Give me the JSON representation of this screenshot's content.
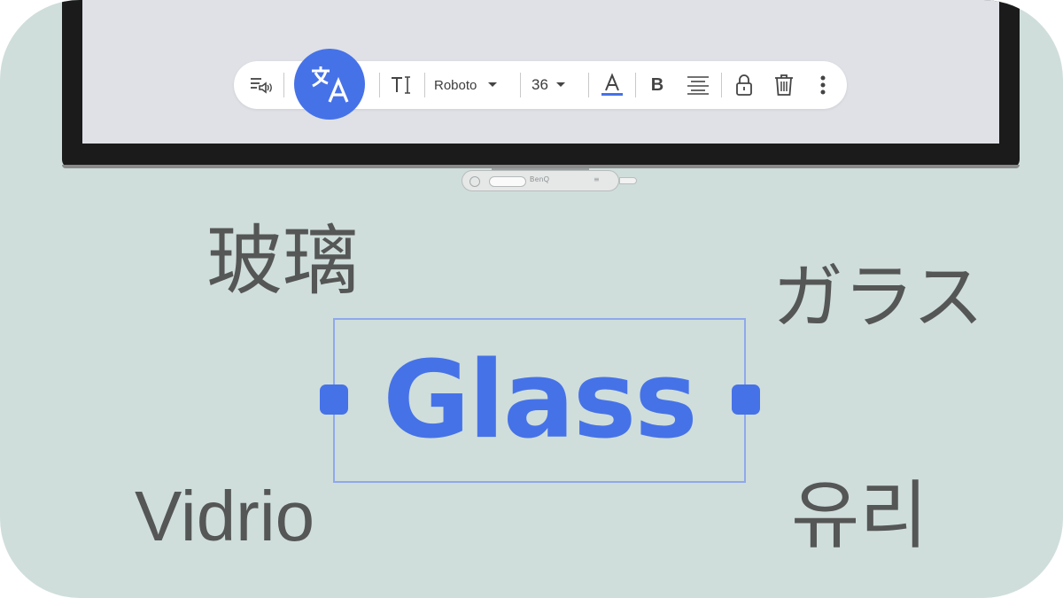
{
  "toolbar": {
    "font_name": "Roboto",
    "font_size": "36",
    "text_color": "#4672e8",
    "bold_label": "B",
    "icons": [
      "text-to-speech-icon",
      "translate-icon",
      "text-style-icon",
      "dropdown-caret-icon",
      "text-color-icon",
      "bold-icon",
      "align-center-icon",
      "lock-icon",
      "trash-icon",
      "more-vert-icon"
    ]
  },
  "device": {
    "brand": "BenQ"
  },
  "canvas": {
    "selected_text": "Glass",
    "translations": {
      "chinese": "玻璃",
      "japanese": "ガラス",
      "spanish": "Vidrio",
      "korean": "유리"
    }
  },
  "colors": {
    "background": "#cfdedb",
    "accent": "#4672e8",
    "selection_border": "#8fa8ec",
    "word_gray": "#555656",
    "screen": "#dfe1e6",
    "bezel": "#1b1b1b"
  }
}
